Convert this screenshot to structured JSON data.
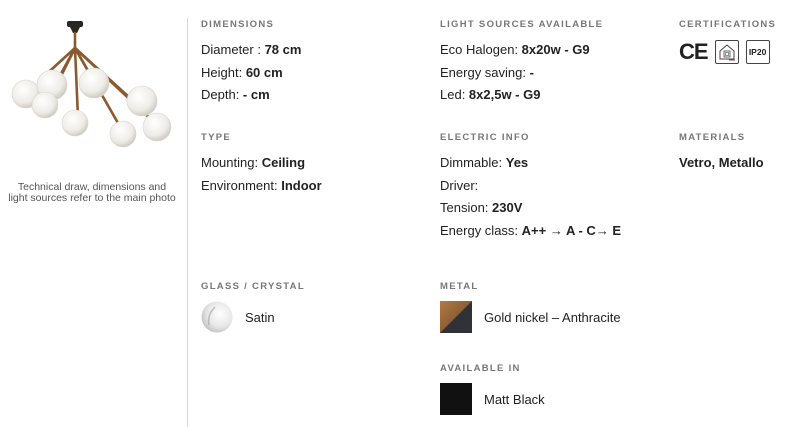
{
  "left": {
    "caption": "Technical draw, dimensions and light sources refer to the main photo"
  },
  "dimensions": {
    "title": "DIMENSIONS",
    "rows": [
      {
        "label": "Diameter : ",
        "value": "78 cm"
      },
      {
        "label": "Height: ",
        "value": "60 cm"
      },
      {
        "label": "Depth: ",
        "value": "- cm"
      }
    ]
  },
  "light_sources": {
    "title": "LIGHT SOURCES AVAILABLE",
    "rows": [
      {
        "label": "Eco Halogen: ",
        "value": "8x20w - G9"
      },
      {
        "label": "Energy saving: ",
        "value": "-"
      },
      {
        "label": "Led: ",
        "value": "8x2,5w - G9"
      }
    ]
  },
  "certifications": {
    "title": "CERTIFICATIONS",
    "ce_mark": "CE",
    "ip_rating": "IP20",
    "icons": [
      "ce-mark-icon",
      "class-ii-indoor-icon",
      "ip20-icon"
    ]
  },
  "type": {
    "title": "TYPE",
    "rows": [
      {
        "label": "Mounting: ",
        "value": "Ceiling"
      },
      {
        "label": "Environment: ",
        "value": "Indoor"
      }
    ]
  },
  "electric": {
    "title": "ELECTRIC INFO",
    "rows": [
      {
        "label": "Dimmable: ",
        "value": "Yes"
      },
      {
        "label": "Driver: ",
        "value": ""
      },
      {
        "label": "Tension: ",
        "value": "230V"
      },
      {
        "label": "Energy class: ",
        "value": "A++ → A - C→ E"
      }
    ]
  },
  "materials": {
    "title": "MATERIALS",
    "value": "Vetro, Metallo"
  },
  "glass": {
    "title": "GLASS / CRYSTAL",
    "label": "Satin"
  },
  "metal": {
    "title": "METAL",
    "label": "Gold nickel – Anthracite"
  },
  "available": {
    "title": "AVAILABLE IN",
    "label": "Matt Black"
  },
  "colors": {
    "text": "#222222",
    "section_title": "#777777",
    "divider": "#d6d6d6",
    "gold": "#9a6a3a",
    "anthracite": "#2f3238",
    "matt_black": "#111111"
  }
}
